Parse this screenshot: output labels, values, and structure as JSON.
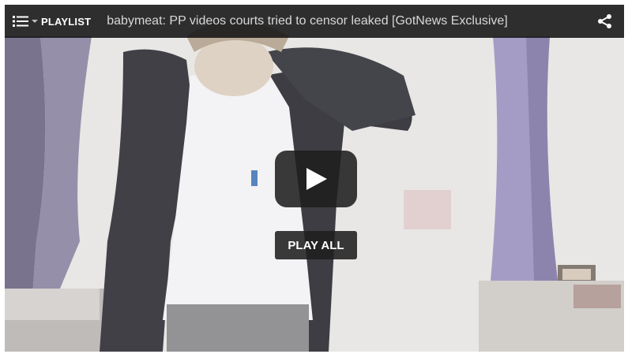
{
  "player": {
    "playlist_label": "PLAYLIST",
    "video_title": "babymeat: PP videos courts tried to censor leaked [GotNews Exclusive]",
    "play_all_label": "PLAY ALL"
  },
  "icons": {
    "playlist": "list-icon",
    "dropdown": "caret-down-icon",
    "share": "share-icon",
    "play": "play-icon"
  },
  "colors": {
    "bar_background": "#141414",
    "title_text": "#d8d8d8",
    "button_background": "#1f1f1f"
  }
}
